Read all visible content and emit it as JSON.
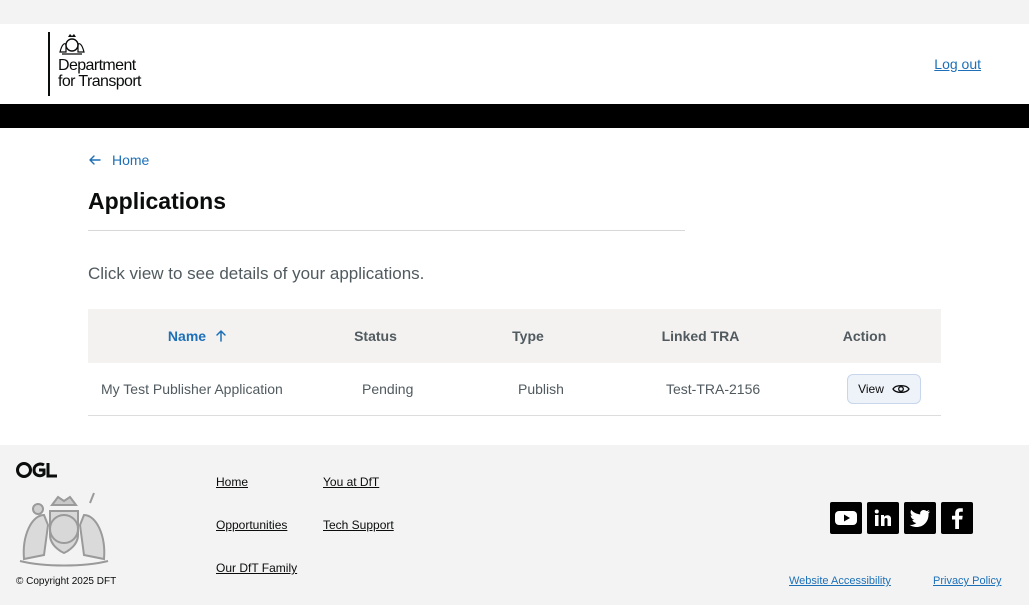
{
  "header": {
    "logo_line1": "Department",
    "logo_line2": "for Transport",
    "logout_label": "Log out"
  },
  "breadcrumb": {
    "back_label": "Home"
  },
  "page": {
    "title": "Applications",
    "lead": "Click view to see details of your applications."
  },
  "table": {
    "columns": [
      "Name",
      "Status",
      "Type",
      "Linked TRA",
      "Action"
    ],
    "rows": [
      {
        "name": "My Test Publisher Application",
        "status": "Pending",
        "type": "Publish",
        "linked_tra": "Test-TRA-2156",
        "action_label": "View"
      }
    ]
  },
  "footer": {
    "copyright": "© Copyright 2025 DFT",
    "links": [
      "Home",
      "You at DfT",
      "Opportunities",
      "Tech Support",
      "Our DfT Family"
    ],
    "bottom_links": [
      "Website Accessibility",
      "Privacy Policy"
    ],
    "social_icons": [
      "youtube-icon",
      "linkedin-icon",
      "twitter-icon",
      "facebook-icon"
    ]
  },
  "colors": {
    "link": "#1d70b8",
    "header_bar": "#000000",
    "table_header_bg": "#f3f2f1"
  }
}
